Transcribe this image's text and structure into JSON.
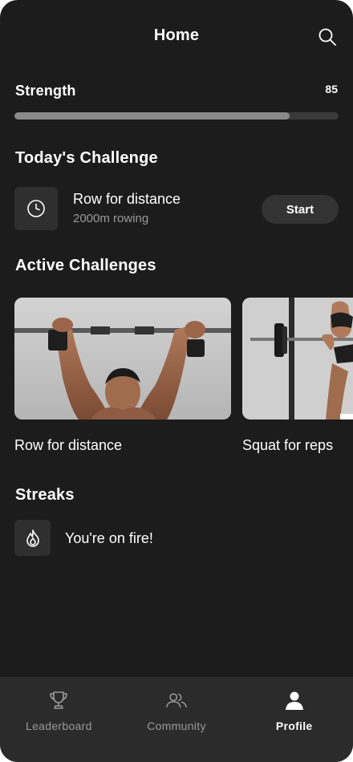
{
  "header": {
    "title": "Home",
    "search_icon": "search-icon"
  },
  "strength": {
    "label": "Strength",
    "value": "85",
    "progress_fraction": 0.85
  },
  "todays_challenge": {
    "section_title": "Today's Challenge",
    "icon": "clock-icon",
    "name": "Row for distance",
    "subtitle": "2000m rowing",
    "start_label": "Start"
  },
  "active_challenges": {
    "section_title": "Active Challenges",
    "cards": [
      {
        "label": "Row for distance",
        "image": "barbell-overhead-photo"
      },
      {
        "label": "Squat for reps",
        "image": "squat-rack-photo"
      }
    ]
  },
  "streaks": {
    "section_title": "Streaks",
    "icon": "flame-icon",
    "text": "You're on fire!"
  },
  "tabbar": {
    "tabs": [
      {
        "label": "Leaderboard",
        "icon": "trophy-icon",
        "active": false
      },
      {
        "label": "Community",
        "icon": "people-icon",
        "active": false
      },
      {
        "label": "Profile",
        "icon": "person-icon",
        "active": true
      }
    ]
  },
  "colors": {
    "background": "#1c1c1c",
    "tile": "#2f2f2f",
    "tabbar": "#2b2b2b",
    "progress_fill": "#8a8a8a",
    "progress_track": "#3a3a3a",
    "muted_text": "#9a9a9a"
  }
}
